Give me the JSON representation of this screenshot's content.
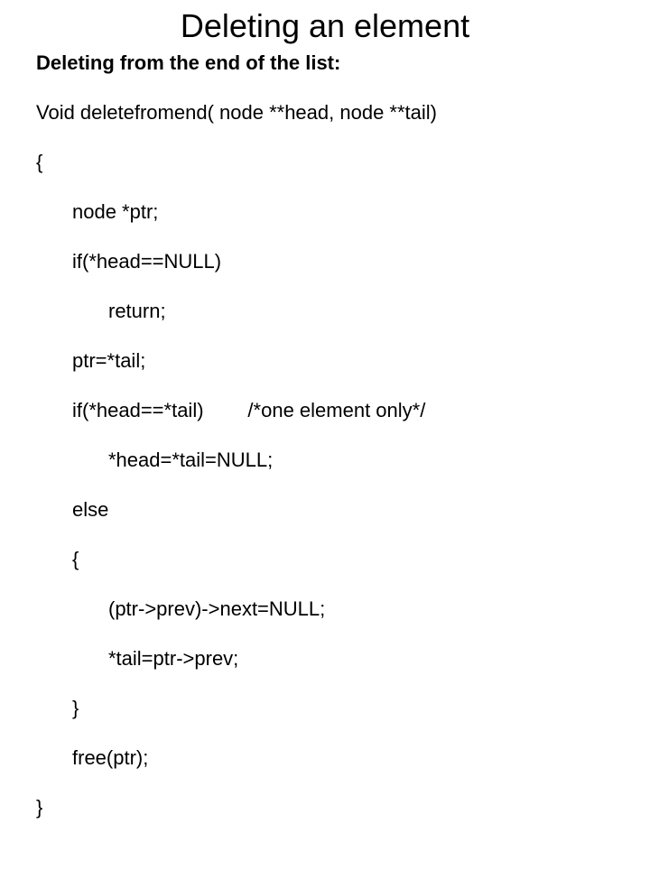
{
  "title": "Deleting an element",
  "subtitle": "Deleting from the end of the list:",
  "code": {
    "l1": "Void deletefromend( node **head, node **tail)",
    "l2": "{",
    "l3": "node *ptr;",
    "l4": "if(*head==NULL)",
    "l5": "return;",
    "l6": "ptr=*tail;",
    "l7": "if(*head==*tail)        /*one element only*/",
    "l8": "*head=*tail=NULL;",
    "l9": "else",
    "l10": "{",
    "l11": "(ptr->prev)->next=NULL;",
    "l12": "*tail=ptr->prev;",
    "l13": "}",
    "l14": "free(ptr);",
    "l15": "}"
  }
}
